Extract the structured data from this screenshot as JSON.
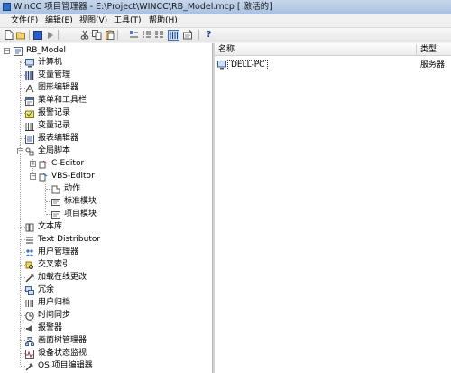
{
  "window": {
    "title": "WinCC 项目管理器 - E:\\Project\\WINCC\\RB_Model.mcp [ 激活的]"
  },
  "menu": [
    {
      "label": "文件(F)"
    },
    {
      "label": "编辑(E)"
    },
    {
      "label": "视图(V)"
    },
    {
      "label": "工具(T)"
    },
    {
      "label": "帮助(H)"
    }
  ],
  "toolbar": {
    "icons": [
      "new-icon",
      "open-icon",
      "activate-icon",
      "run-icon",
      "cut-icon",
      "copy-icon",
      "paste-icon",
      "large-icons-icon",
      "small-icons-icon",
      "list-icon",
      "details-icon",
      "properties-icon",
      "help-icon"
    ],
    "help_label": "?"
  },
  "tree": {
    "root": "RB_Model",
    "items": [
      {
        "label": "计算机",
        "icon": "computer-icon"
      },
      {
        "label": "变量管理",
        "icon": "tag-management-icon"
      },
      {
        "label": "图形编辑器",
        "icon": "graphics-designer-icon"
      },
      {
        "label": "菜单和工具栏",
        "icon": "menus-toolbars-icon"
      },
      {
        "label": "报警记录",
        "icon": "alarm-logging-icon"
      },
      {
        "label": "变量记录",
        "icon": "tag-logging-icon"
      },
      {
        "label": "报表编辑器",
        "icon": "report-designer-icon"
      },
      {
        "label": "全局脚本",
        "icon": "global-script-icon"
      },
      {
        "label": "C-Editor",
        "icon": "c-editor-icon"
      },
      {
        "label": "VBS-Editor",
        "icon": "vbs-editor-icon"
      },
      {
        "label": "动作",
        "icon": "action-icon"
      },
      {
        "label": "标准模块",
        "icon": "standard-module-icon"
      },
      {
        "label": "项目模块",
        "icon": "project-module-icon"
      },
      {
        "label": "文本库",
        "icon": "text-library-icon"
      },
      {
        "label": "Text Distributor",
        "icon": "text-distributor-icon"
      },
      {
        "label": "用户管理器",
        "icon": "user-administrator-icon"
      },
      {
        "label": "交叉索引",
        "icon": "cross-reference-icon"
      },
      {
        "label": "加载在线更改",
        "icon": "load-online-changes-icon"
      },
      {
        "label": "冗余",
        "icon": "redundancy-icon"
      },
      {
        "label": "用户归档",
        "icon": "user-archive-icon"
      },
      {
        "label": "时间同步",
        "icon": "time-sync-icon"
      },
      {
        "label": "报警器",
        "icon": "horn-icon"
      },
      {
        "label": "画面树管理器",
        "icon": "picture-tree-icon"
      },
      {
        "label": "设备状态监视",
        "icon": "lifebeat-monitoring-icon"
      },
      {
        "label": "OS 项目编辑器",
        "icon": "os-project-editor-icon"
      }
    ]
  },
  "list": {
    "columns": [
      {
        "label": "名称"
      },
      {
        "label": "类型"
      }
    ],
    "rows": [
      {
        "name": "DELL-PC",
        "type": "服务器"
      }
    ]
  }
}
